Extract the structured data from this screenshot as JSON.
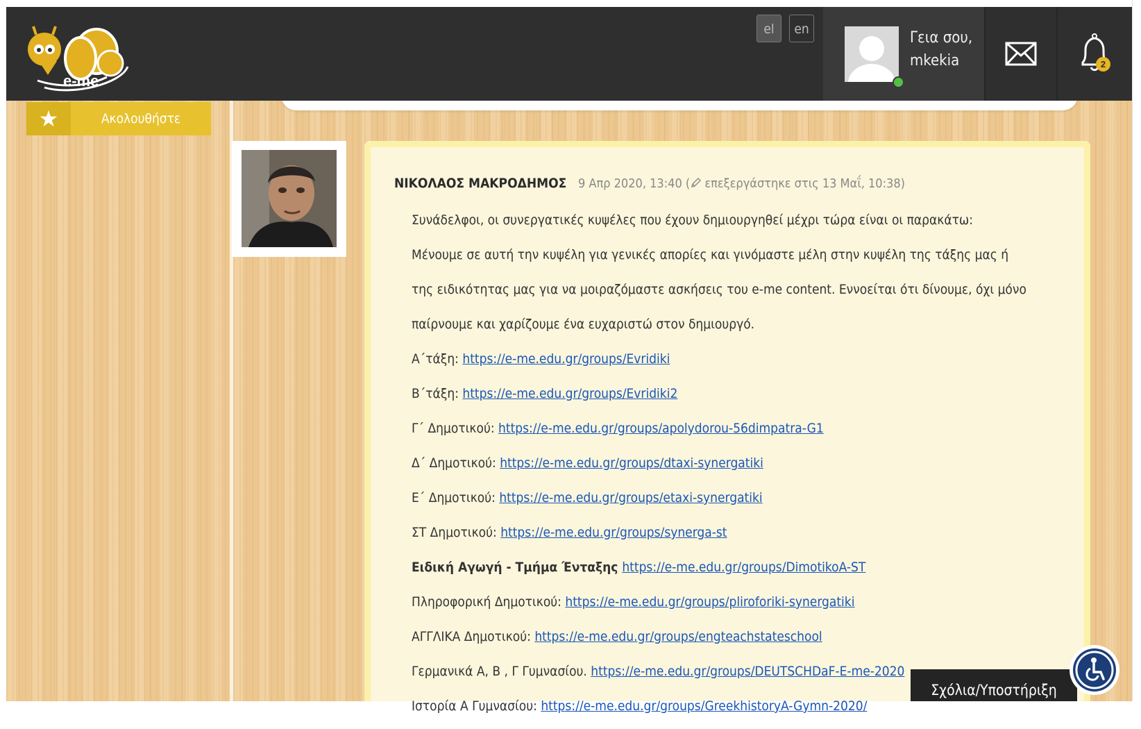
{
  "header": {
    "logo_text": "e-me",
    "lang": [
      "el",
      "en"
    ],
    "greeting": {
      "line1": "Γεια σου,",
      "line2": "mkekia"
    },
    "notification_count": "2"
  },
  "sidebar": {
    "follow_label": "Ακολουθήστε"
  },
  "post": {
    "author": "ΝΙΚΟΛΑΟΣ ΜΑΚΡΟΔΗΜΟΣ",
    "date": "9 Απρ 2020, 13:40 (",
    "edited": "επεξεργάστηκε στις 13 Μαΐ, 10:38)",
    "intro": [
      "Συνάδελφοι, οι συνεργατικές κυψέλες που έχουν δημιουργηθεί μέχρι τώρα είναι οι παρακάτω:",
      "Μένουμε σε αυτή την κυψέλη για γενικές απορίες και γινόμαστε μέλη στην κυψέλη της τάξης μας ή",
      "της ειδικότητας μας για να μοιραζόμαστε ασκήσεις του e-me content. Εννοείται ότι δίνουμε, όχι μόνο",
      "παίρνουμε και χαρίζουμε ένα ευχαριστώ στον δημιουργό."
    ],
    "links": [
      {
        "label": "Α΄τάξη: ",
        "url": "https://e-me.edu.gr/groups/Evridiki",
        "bold": false
      },
      {
        "label": "Β΄τάξη: ",
        "url": "https://e-me.edu.gr/groups/Evridiki2",
        "bold": false
      },
      {
        "label": "Γ΄ Δημοτικού: ",
        "url": "https://e-me.edu.gr/groups/apolydorou-56dimpatra-G1",
        "bold": false
      },
      {
        "label": "Δ΄ Δημοτικού: ",
        "url": "https://e-me.edu.gr/groups/dtaxi-synergatiki",
        "bold": false
      },
      {
        "label": "Ε΄ Δημοτικού:  ",
        "url": "https://e-me.edu.gr/groups/etaxi-synergatiki",
        "bold": false
      },
      {
        "label": "ΣΤ Δημοτικού: ",
        "url": "https://e-me.edu.gr/groups/synerga-st",
        "bold": false
      },
      {
        "label": "Ειδική Αγωγή - Τμήμα Ένταξης ",
        "url": "https://e-me.edu.gr/groups/DimotikoA-ST",
        "bold": true
      },
      {
        "label": "Πληροφορική Δημοτικού:  ",
        "url": "https://e-me.edu.gr/groups/pliroforiki-synergatiki ",
        "bold": false
      },
      {
        "label": "ΑΓΓΛΙΚΑ Δημοτικού: ",
        "url": "https://e-me.edu.gr/groups/engteachstateschool",
        "bold": false
      },
      {
        "label": "Γερμανικά Α, Β , Γ Γυμνασίου. ",
        "url": "https://e-me.edu.gr/groups/DEUTSCHDaF-E-me-2020",
        "bold": false
      },
      {
        "label": "Ιστορία Α Γυμνασίου: ",
        "url": "https://e-me.edu.gr/groups/GreekhistoryA-Gymn-2020/",
        "bold": false
      }
    ]
  },
  "feedback_label": "Σχόλια/Υποστήριξη",
  "icons": {
    "logo": "bee-logo-icon",
    "mail": "envelope-icon",
    "bell": "bell-icon",
    "star": "star-icon",
    "edit": "pencil-icon",
    "accessibility": "wheelchair-icon"
  },
  "colors": {
    "header_bg": "#2f2f2f",
    "accent_yellow": "#e7c22e",
    "link": "#1a56b8",
    "card_bg": "#fbf6dc",
    "card_border": "#fcf1a9",
    "online": "#52c045",
    "a11y_blue": "#1b3e79"
  }
}
